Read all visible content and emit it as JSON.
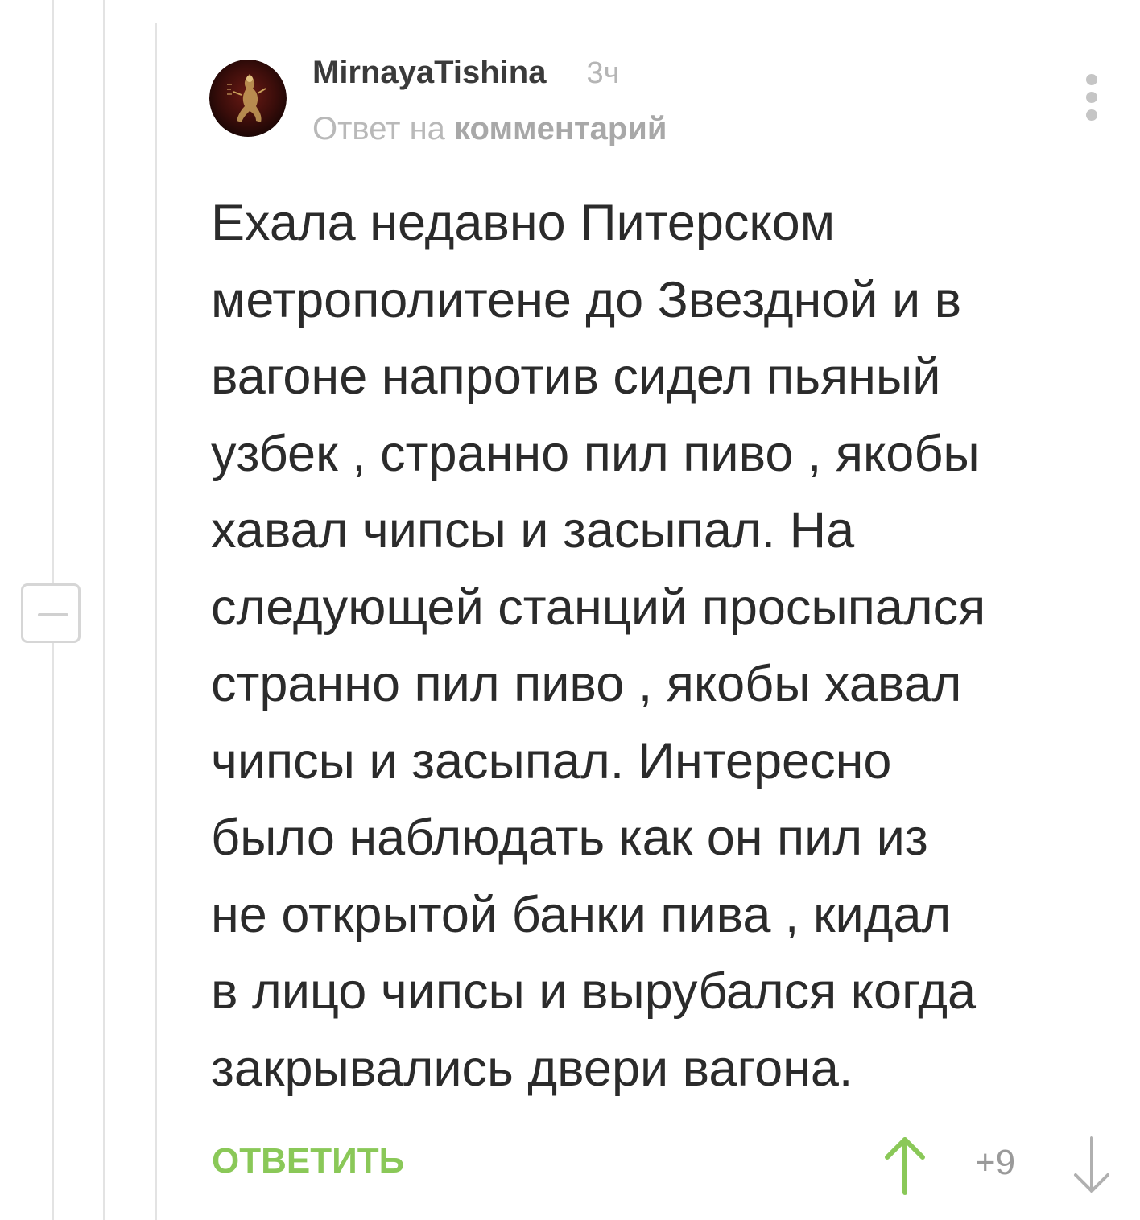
{
  "comment": {
    "author": "MirnayaTishina",
    "time_ago": "3ч",
    "reply_prefix": "Ответ на",
    "reply_target": "комментарий",
    "text": "Ехала недавно Питерском\nметрополитене до Звездной и в\nвагоне напротив сидел пьяный\nузбек  , странно пил пиво , якобы\nхавал чипсы и засыпал. На\nследующей станций просыпался\nстранно пил пиво , якобы хавал\nчипсы и засыпал. Интересно\nбыло наблюдать как он пил из\nне открытой банки пива , кидал\nв лицо чипсы и вырубался когда\nзакрывались двери вагона.",
    "reply_button_label": "ОТВЕТИТЬ",
    "rating": "+9"
  },
  "icons": {
    "avatar": "avatar-image",
    "more": "more-vertical-icon",
    "collapse": "minus-icon",
    "upvote": "arrow-up-icon",
    "downvote": "arrow-down-icon"
  },
  "colors": {
    "reply_button": "#8ac858",
    "upvote": "#8ac858",
    "downvote": "#b0b0b0",
    "thread_line": "#e3e3e3"
  }
}
